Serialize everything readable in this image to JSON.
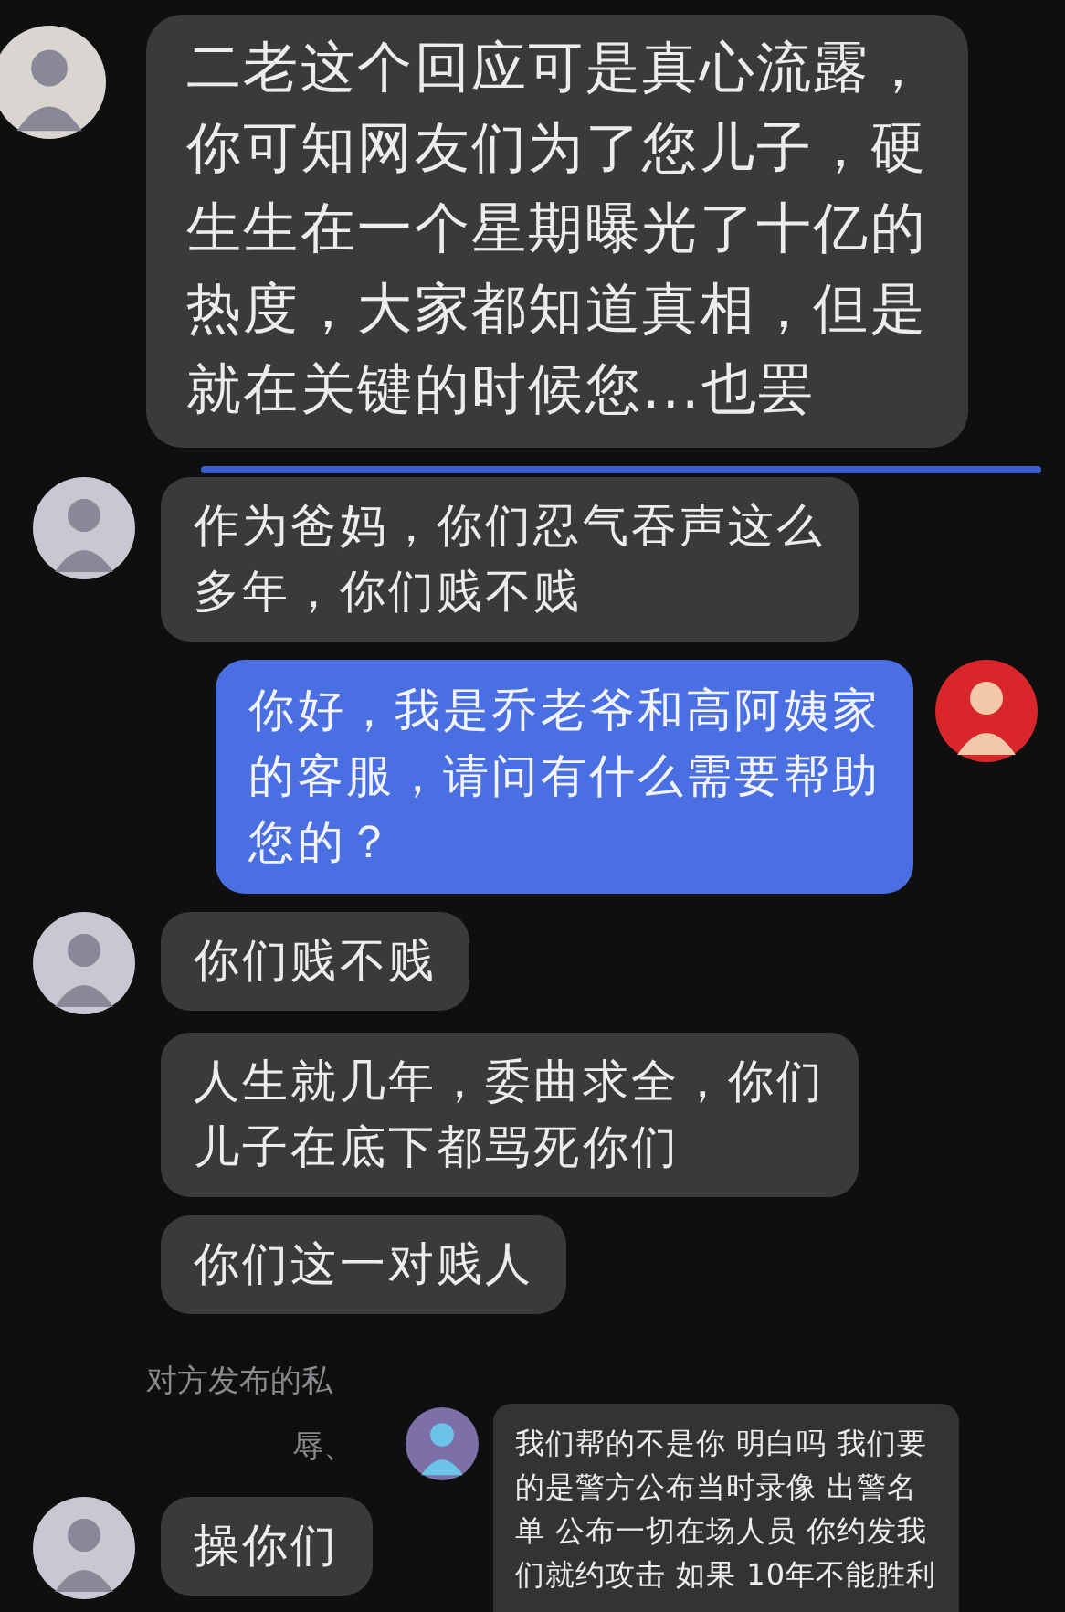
{
  "messages": [
    {
      "kind": "received",
      "avatar": true,
      "lines": [
        "二老这个回应可是真心流露，",
        "你可知网友们为了您儿子，硬",
        "生生在一个星期曝光了十亿的",
        "热度，大家都知道真相，但是",
        "就在关键的时候您...也罢"
      ]
    },
    {
      "kind": "received",
      "avatar": true,
      "lines": [
        "作为爸妈，你们忍气吞声这么",
        "多年，你们贱不贱"
      ]
    },
    {
      "kind": "sent",
      "avatar": true,
      "lines": [
        "你好，我是乔老爷和高阿姨家",
        "的客服，请问有什么需要帮助",
        "您的？"
      ]
    },
    {
      "kind": "received",
      "avatar": true,
      "lines": [
        "你们贱不贱"
      ]
    },
    {
      "kind": "received",
      "avatar": false,
      "lines": [
        "人生就几年，委曲求全，你们",
        "儿子在底下都骂死你们"
      ]
    },
    {
      "kind": "received",
      "avatar": false,
      "lines": [
        "你们这一对贱人"
      ]
    }
  ],
  "notice": [
    "对方发布的私",
    "辱、"
  ],
  "last_message": {
    "kind": "received",
    "avatar": true,
    "lines": [
      "操你们"
    ]
  },
  "overlay": {
    "lines": [
      "我们帮的不是你 明白吗 我们要",
      "的是警方公布当时录像 出警名",
      "单 公布一切在场人员 你约发我",
      "们就约攻击 如果 10年不能胜利"
    ]
  }
}
